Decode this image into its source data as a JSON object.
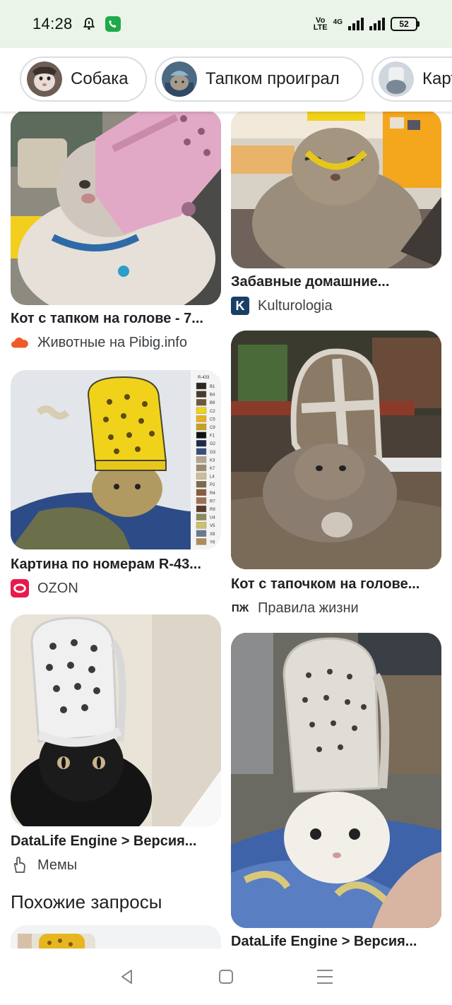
{
  "status_bar": {
    "time": "14:28",
    "network": "4G",
    "volte_line1": "Vo",
    "volte_line2": "LTE",
    "battery": "52"
  },
  "chips": [
    {
      "label": "Собака",
      "thumb_color": "#7a6b63"
    },
    {
      "label": "Тапком проиграл",
      "thumb_color": "#5d7d9a"
    },
    {
      "label": "Карт",
      "thumb_color": "#9aa6b4"
    }
  ],
  "results": [
    {
      "title": "Кот с тапком на голове - 7...",
      "source": "Животные на Pibig.info",
      "source_icon": "cloud-icon",
      "icon_color": "#f05a28"
    },
    {
      "title": "Забавные домашние...",
      "source": "Kulturologia",
      "source_icon": "k-logo-icon",
      "icon_letter": "K",
      "icon_color": "#2a6fa8"
    },
    {
      "title": "Картина по номерам R-43...",
      "source": "OZON",
      "source_icon": "ozon-logo-icon",
      "icon_color": "#e8194b"
    },
    {
      "title": "Кот с тапочком на голове...",
      "source": "Правила жизни",
      "source_icon": "pzh-logo-icon",
      "icon_letter": "ПЖ",
      "icon_color": "#222222"
    },
    {
      "title": "DataLife Engine > Версия...",
      "source": "Мемы",
      "source_icon": "hand-icon",
      "icon_color": "#555555"
    },
    {
      "title": "DataLife Engine > Версия...",
      "source": "",
      "source_icon": "",
      "icon_color": ""
    }
  ],
  "paint_palette": {
    "header": "R-433",
    "codes": [
      "B1",
      "B4",
      "B9",
      "C2",
      "C5",
      "C9",
      "F1",
      "G2",
      "G3",
      "K3",
      "K7",
      "L4",
      "P2",
      "R4",
      "R7",
      "R9",
      "U4",
      "V5",
      "X8",
      "Y6"
    ]
  },
  "related": {
    "title": "Похожие запросы"
  },
  "colors": {
    "status_bg": "#eaf4e8",
    "chip_border": "#dadce0"
  }
}
